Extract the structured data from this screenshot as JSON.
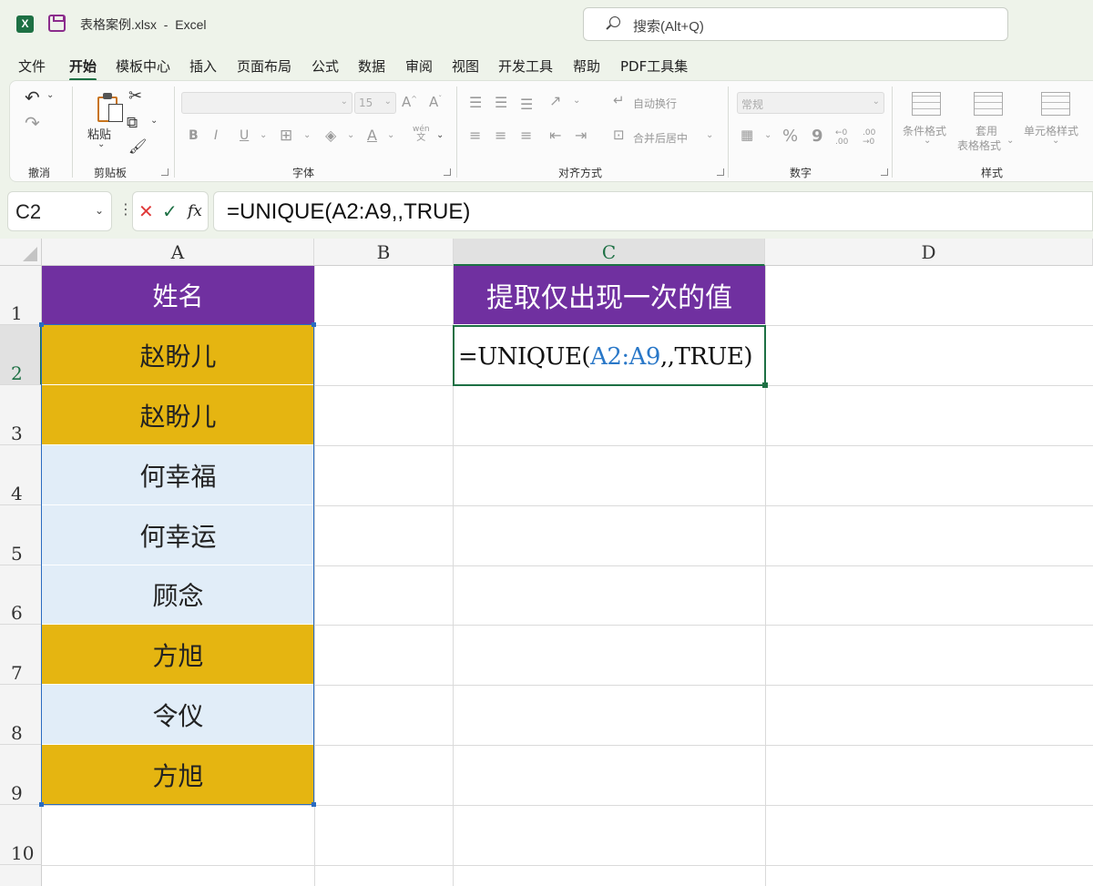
{
  "titlebar": {
    "app_icon": "X",
    "file_name": "表格案例.xlsx",
    "separator": "-",
    "app_name": "Excel",
    "search_placeholder": "搜索(Alt+Q)"
  },
  "menu": [
    "文件",
    "开始",
    "模板中心",
    "插入",
    "页面布局",
    "公式",
    "数据",
    "审阅",
    "视图",
    "开发工具",
    "帮助",
    "PDF工具集"
  ],
  "active_menu": "开始",
  "ribbon": {
    "groups": [
      "撤消",
      "剪贴板",
      "字体",
      "对齐方式",
      "数字",
      "样式"
    ],
    "paste_label": "粘贴",
    "font_size": "15",
    "wrap_text": "自动换行",
    "merge_center": "合并后居中",
    "number_format": "常规",
    "conditional_format": "条件格式",
    "table_format_1": "套用",
    "table_format_2": "表格格式",
    "cell_styles": "单元格样式",
    "wen": "wén",
    "wen_char": "文",
    "bold": "B",
    "italic": "I",
    "underline": "U",
    "percent": "%",
    "comma": "9",
    "dec_inc": "←0 .00",
    "dec_dec": ".00 →0"
  },
  "formula_bar": {
    "name_box": "C2",
    "dots": "⋮",
    "cancel": "✕",
    "enter": "✓",
    "fx": "fx",
    "formula": "=UNIQUE(A2:A9,,TRUE)"
  },
  "columns": [
    "A",
    "B",
    "C",
    "D"
  ],
  "rows": [
    "1",
    "2",
    "3",
    "4",
    "5",
    "6",
    "7",
    "8",
    "9",
    "10"
  ],
  "cells": {
    "A1": "姓名",
    "A": [
      "赵盼儿",
      "赵盼儿",
      "何幸福",
      "何幸运",
      "顾念",
      "方旭",
      "令仪",
      "方旭"
    ],
    "C1": "提取仅出现一次的值",
    "C2_prefix": "=UNIQUE(",
    "C2_ref": "A2:A9",
    "C2_suffix": ",,TRUE)"
  },
  "colors": {
    "header_purple": "#7030a0",
    "gold": "#e5b511",
    "light_blue": "#e1edf8",
    "excel_green": "#1d7044",
    "ref_blue": "#2a78c8"
  }
}
